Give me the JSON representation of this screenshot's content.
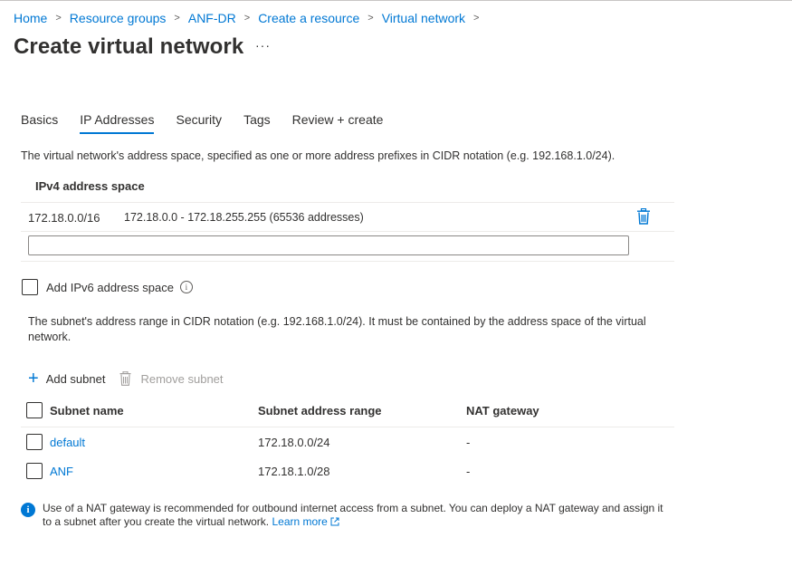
{
  "breadcrumb": {
    "items": [
      "Home",
      "Resource groups",
      "ANF-DR",
      "Create a resource",
      "Virtual network"
    ],
    "separator": ">"
  },
  "page": {
    "title": "Create virtual network",
    "more": "···"
  },
  "tabs": [
    {
      "label": "Basics",
      "active": false
    },
    {
      "label": "IP Addresses",
      "active": true
    },
    {
      "label": "Security",
      "active": false
    },
    {
      "label": "Tags",
      "active": false
    },
    {
      "label": "Review + create",
      "active": false
    }
  ],
  "address_space": {
    "description": "The virtual network's address space, specified as one or more address prefixes in CIDR notation (e.g. 192.168.1.0/24).",
    "header": "IPv4 address space",
    "rows": [
      {
        "prefix": "172.18.0.0/16",
        "range": "172.18.0.0 - 172.18.255.255 (65536 addresses)"
      }
    ],
    "input_value": ""
  },
  "ipv6": {
    "label": "Add IPv6 address space",
    "checked": false
  },
  "subnets": {
    "description": "The subnet's address range in CIDR notation (e.g. 192.168.1.0/24). It must be contained by the address space of the virtual network.",
    "add_label": "Add subnet",
    "remove_label": "Remove subnet",
    "columns": [
      "Subnet name",
      "Subnet address range",
      "NAT gateway"
    ],
    "rows": [
      {
        "name": "default",
        "range": "172.18.0.0/24",
        "nat": "-"
      },
      {
        "name": "ANF",
        "range": "172.18.1.0/28",
        "nat": "-"
      }
    ]
  },
  "info": {
    "text": "Use of a NAT gateway is recommended for outbound internet access from a subnet. You can deploy a NAT gateway and assign it to a subnet after you create the virtual network.",
    "link": "Learn more"
  },
  "colors": {
    "accent": "#0078d4",
    "text": "#323130",
    "disabled": "#a19f9d",
    "divider": "#edebe9"
  }
}
